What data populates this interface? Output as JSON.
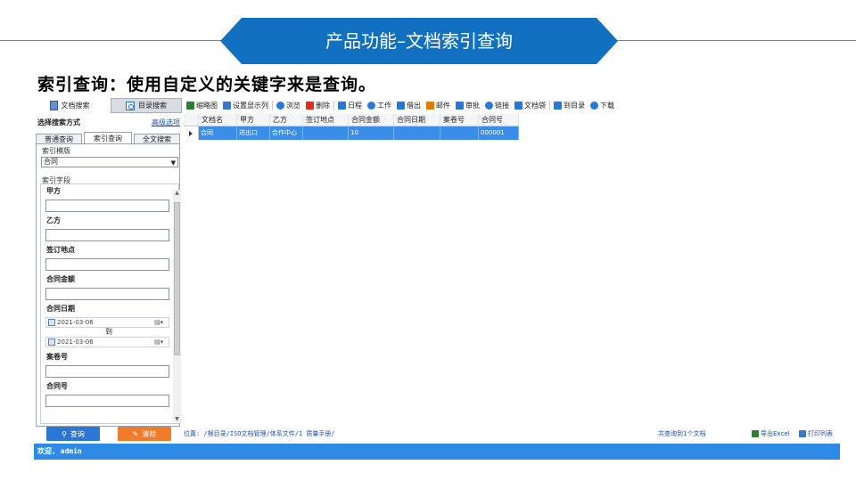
{
  "banner": {
    "title": "产品功能–文档索引查询"
  },
  "subtitle": "索引查询：使用自定义的关键字来是查询。",
  "left_panel": {
    "tabs": [
      {
        "label": "文档搜索"
      },
      {
        "label": "目录搜索"
      }
    ],
    "search_mode_label": "选择搜索方式",
    "advanced_link": "高级选项",
    "mode_tabs": [
      {
        "label": "普通查询"
      },
      {
        "label": "索引查询"
      },
      {
        "label": "全文搜索"
      }
    ],
    "template_group": "索引模版",
    "template_value": "合同",
    "fields_group": "索引字段",
    "fields": [
      {
        "label": "甲方",
        "value": ""
      },
      {
        "label": "乙方",
        "value": ""
      },
      {
        "label": "签订地点",
        "value": ""
      },
      {
        "label": "合同金额",
        "value": ""
      },
      {
        "label": "合同日期",
        "date_from": "2021-03-06",
        "date_to": "2021-03-06",
        "to_label": "到"
      },
      {
        "label": "案卷号",
        "value": ""
      },
      {
        "label": "合同号",
        "value": ""
      }
    ],
    "query_button": "查询",
    "clear_button": "清除"
  },
  "toolbar": {
    "items": [
      {
        "label": "缩略图",
        "icon": "thumbnail-icon",
        "color": "#2e7d32"
      },
      {
        "label": "设置显示列",
        "icon": "columns-icon",
        "color": "#3a78c4"
      },
      {
        "label": "浏览",
        "icon": "eye-icon",
        "color": "#2a78d4"
      },
      {
        "label": "删除",
        "icon": "trash-icon",
        "color": "#d93025"
      },
      {
        "label": "日程",
        "icon": "calendar-icon",
        "color": "#2a78d4"
      },
      {
        "label": "工作",
        "icon": "person-icon",
        "color": "#2a78d4"
      },
      {
        "label": "借出",
        "icon": "lend-icon",
        "color": "#2a78d4"
      },
      {
        "label": "邮件",
        "icon": "mail-icon",
        "color": "#e07b00"
      },
      {
        "label": "审批",
        "icon": "approve-icon",
        "color": "#2a78d4"
      },
      {
        "label": "链接",
        "icon": "link-icon",
        "color": "#2a78d4"
      },
      {
        "label": "文档袋",
        "icon": "stack-icon",
        "color": "#2a78d4"
      },
      {
        "label": "到目录",
        "icon": "folder-doc-icon",
        "color": "#2a78d4"
      },
      {
        "label": "下载",
        "icon": "cloud-download-icon",
        "color": "#2a78d4"
      }
    ]
  },
  "grid": {
    "columns": [
      "文档名",
      "甲方",
      "乙方",
      "签订地点",
      "合同金额",
      "合同日期",
      "案卷号",
      "合同号"
    ],
    "rows": [
      [
        "合同",
        "进出口",
        "合作中心",
        "",
        "10",
        "",
        "",
        "000001"
      ]
    ]
  },
  "status": {
    "location": "位置: /根目录/ISO文档管理/体系文件/1 质量手册/",
    "count": "共查询到1个文档",
    "export": "导出Excel",
    "print": "打印列表"
  },
  "welcome": "欢迎, admin"
}
